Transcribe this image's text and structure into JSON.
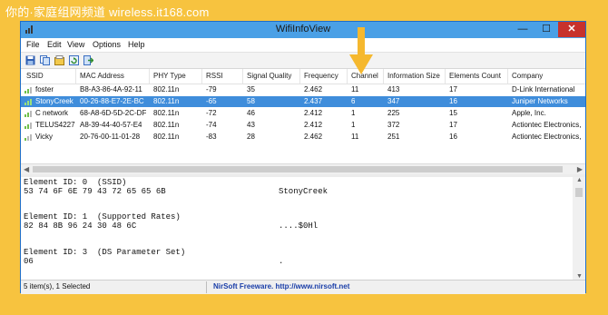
{
  "watermark": "你的·家庭组网频道 wireless.it168.com",
  "window": {
    "title": "WifiInfoView",
    "controls": {
      "minimize": "—",
      "maximize": "☐",
      "close": "✕"
    }
  },
  "menu": [
    "File",
    "Edit",
    "View",
    "Options",
    "Help"
  ],
  "toolbar": {
    "icons": [
      "save-icon",
      "copy-icon",
      "properties-icon",
      "refresh-icon",
      "exit-icon"
    ]
  },
  "table": {
    "columns": [
      "SSID",
      "MAC Address",
      "PHY Type",
      "RSSI",
      "Signal Quality",
      "Frequency",
      "Channel",
      "Information Size",
      "Elements Count",
      "Company"
    ],
    "rows": [
      {
        "ssid": "foster",
        "mac": "B8-A3-86-4A-92-11",
        "phy": "802.11n",
        "rssi": "-79",
        "quality": "35",
        "freq": "2.462",
        "channel": "11",
        "info_size": "413",
        "elements": "17",
        "company": "D-Link International"
      },
      {
        "ssid": "StonyCreek",
        "mac": "00-26-88-E7-2E-BC",
        "phy": "802.11n",
        "rssi": "-65",
        "quality": "58",
        "freq": "2.437",
        "channel": "6",
        "info_size": "347",
        "elements": "16",
        "company": "Juniper Networks",
        "selected": true
      },
      {
        "ssid": "C network",
        "mac": "68-A8-6D-5D-2C-DF",
        "phy": "802.11n",
        "rssi": "-72",
        "quality": "46",
        "freq": "2.412",
        "channel": "1",
        "info_size": "225",
        "elements": "15",
        "company": "Apple, Inc."
      },
      {
        "ssid": "TELUS4227",
        "mac": "A8-39-44-40-57-E4",
        "phy": "802.11n",
        "rssi": "-74",
        "quality": "43",
        "freq": "2.412",
        "channel": "1",
        "info_size": "372",
        "elements": "17",
        "company": "Actiontec Electronics,"
      },
      {
        "ssid": "Vicky",
        "mac": "20-76-00-11-01-28",
        "phy": "802.11n",
        "rssi": "-83",
        "quality": "28",
        "freq": "2.462",
        "channel": "11",
        "info_size": "251",
        "elements": "16",
        "company": "Actiontec Electronics,"
      }
    ]
  },
  "details": [
    {
      "id": "Element ID: 0  (SSID)",
      "hex": "53 74 6F 6E 79 43 72 65 65 6B",
      "ascii": "StonyCreek"
    },
    {
      "id": "Element ID: 1  (Supported Rates)",
      "hex": "82 84 8B 96 24 30 48 6C",
      "ascii": "....$0Hl"
    },
    {
      "id": "Element ID: 3  (DS Parameter Set)",
      "hex": "06",
      "ascii": "."
    }
  ],
  "status": {
    "items": "5 item(s), 1 Selected",
    "credit": "NirSoft Freeware.  http://www.nirsoft.net"
  },
  "colors": {
    "background": "#f7c33f",
    "titlebar": "#4aa0e6",
    "selection": "#3f8ddb",
    "annotation_arrow": "#f5b82e"
  }
}
